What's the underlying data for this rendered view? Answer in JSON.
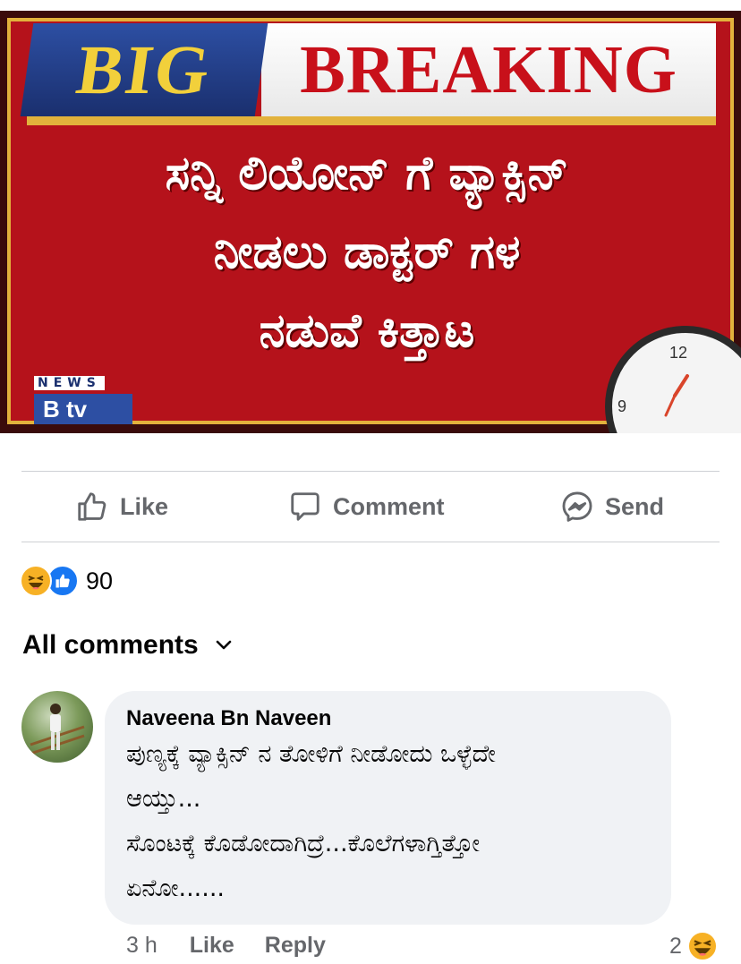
{
  "news_image": {
    "banner_big": "BIG",
    "banner_breaking": "BREAKING",
    "headline_lines": [
      "ಸನ್ನಿ ಲಿಯೋನ್ ಗೆ ವ್ಯಾಕ್ಸಿನ್",
      "ನೀಡಲು ಡಾಕ್ಟರ್ ಗಳ",
      "ನಡುವೆ ಕಿತ್ತಾಟ"
    ],
    "channel_label": "NEWS",
    "channel_logo": "B tv",
    "clock_numbers": [
      "12",
      "9"
    ]
  },
  "actions": {
    "like_label": "Like",
    "comment_label": "Comment",
    "send_label": "Send"
  },
  "reactions": {
    "count": "90",
    "icons": [
      "haha-icon",
      "like-icon"
    ]
  },
  "comments_filter": {
    "label": "All comments",
    "icon": "chevron-down-icon"
  },
  "comment": {
    "author": "Naveena Bn Naveen",
    "lines": [
      "ಪುಣ್ಯಕ್ಕೆ ವ್ಯಾಕ್ಸಿನ್ ನ ತೋಳಿಗೆ ನೀಡೋದು ಒಳ್ಳೆದೇ",
      "ಆಯ್ತು...",
      "ಸೊಂಟಕ್ಕೆ ಕೊಡೋದಾಗಿದ್ರೆ...ಕೊಲೆಗಳಾಗ್ತಿತ್ತೋ",
      "ಏನೋ......"
    ],
    "time": "3 h",
    "like_label": "Like",
    "reply_label": "Reply",
    "reaction_count": "2"
  },
  "colors": {
    "facebook_blue": "#1877f2",
    "secondary_text": "#65676b",
    "bubble_bg": "#f0f2f5",
    "haha_yellow": "#f7b125"
  }
}
